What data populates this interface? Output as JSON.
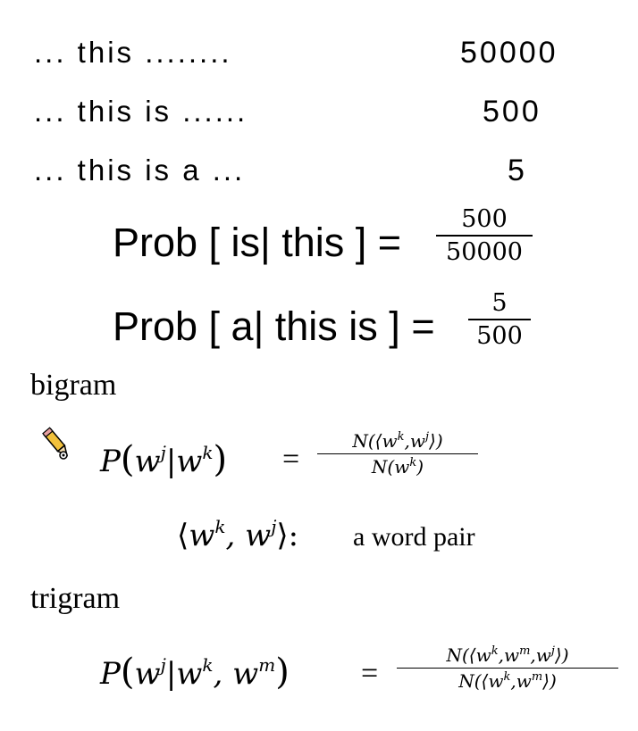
{
  "counts": [
    {
      "phrase": "... this ........",
      "count": "50000"
    },
    {
      "phrase": "... this is ......",
      "count": "500"
    },
    {
      "phrase": "... this is a ...",
      "count": "5"
    }
  ],
  "prob1": {
    "lhs": "Prob [ is| this ] =",
    "num": "500",
    "den": "50000"
  },
  "prob2": {
    "lhs": "Prob [ a| this is ] =",
    "num": "5",
    "den": "500"
  },
  "bigram": {
    "label": "bigram",
    "P": "P",
    "w": "w",
    "j": "j",
    "k": "k",
    "equals": "=",
    "num_text": "N(⟨w",
    "num_mid": ",w",
    "num_end": "⟩)",
    "den_text": "N(w",
    "den_end": ")",
    "pair_text": "a word pair"
  },
  "trigram": {
    "label": "trigram",
    "P": "P",
    "w": "w",
    "j": "j",
    "k": "k",
    "m": "m",
    "equals": "="
  },
  "icon": "pencil-icon"
}
